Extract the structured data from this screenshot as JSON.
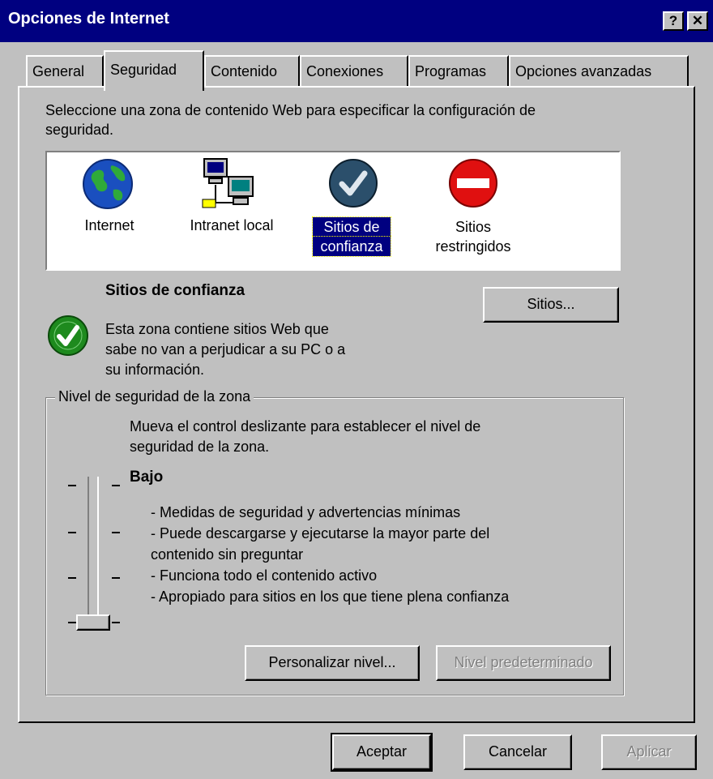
{
  "window": {
    "title": "Opciones de Internet",
    "help_button": "?",
    "close_button": "✕"
  },
  "tabs": [
    {
      "label": "General"
    },
    {
      "label": "Seguridad",
      "active": true
    },
    {
      "label": "Contenido"
    },
    {
      "label": "Conexiones"
    },
    {
      "label": "Programas"
    },
    {
      "label": "Opciones avanzadas"
    }
  ],
  "security": {
    "intro_line1": "Seleccione una zona de contenido Web para especificar la configuración de",
    "intro_line2": "seguridad.",
    "zones": [
      {
        "icon": "globe-icon",
        "label_line1": "Internet",
        "label_line2": ""
      },
      {
        "icon": "network-computers-icon",
        "label_line1": "Intranet local",
        "label_line2": ""
      },
      {
        "icon": "checkmark-circle-icon",
        "label_line1": "Sitios de",
        "label_line2": "confianza",
        "selected": true
      },
      {
        "icon": "no-entry-icon",
        "label_line1": "Sitios",
        "label_line2": "restringidos"
      }
    ],
    "selected_zone": {
      "name": "Sitios de confianza",
      "desc_line1": "Esta zona contiene sitios Web que",
      "desc_line2": "sabe no van a perjudicar a su PC o a",
      "desc_line3": "su información."
    },
    "sites_button": "Sitios...",
    "level_group": {
      "title": "Nivel de seguridad de la zona",
      "instructions_line1": "Mueva el control deslizante para establecer el nivel de",
      "instructions_line2": "seguridad de la zona.",
      "level_name": "Bajo",
      "details": [
        "- Medidas de seguridad y advertencias mínimas",
        "- Puede descargarse y ejecutarse la mayor parte del",
        "contenido sin preguntar",
        "- Funciona todo el contenido activo",
        "- Apropiado para sitios en los que tiene plena confianza"
      ],
      "slider_position_fraction": 0,
      "custom_level_button": "Personalizar nivel...",
      "default_level_button": "Nivel predeterminado"
    }
  },
  "footer": {
    "ok": "Aceptar",
    "cancel": "Cancelar",
    "apply": "Aplicar"
  },
  "colors": {
    "titlebar": "#000080",
    "face": "#c0c0c0",
    "selection": "#000080",
    "trusted_green": "#1e8a1e",
    "restricted_red": "#e01010"
  }
}
